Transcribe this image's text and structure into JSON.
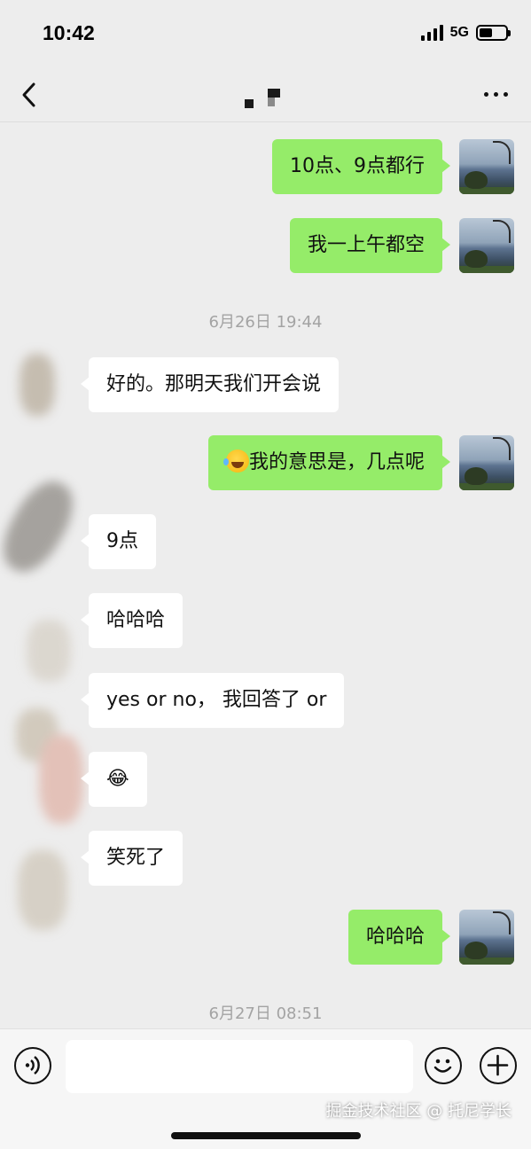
{
  "status_bar": {
    "time": "10:42",
    "network": "5G",
    "battery_level": 0.5
  },
  "nav": {
    "title": ""
  },
  "messages": [
    {
      "direction": "out",
      "text": "10点、9点都行"
    },
    {
      "direction": "out",
      "text": "我一上午都空"
    },
    {
      "type": "timestamp",
      "text": "6月26日 19:44"
    },
    {
      "direction": "in",
      "text": "好的。那明天我们开会说"
    },
    {
      "direction": "out",
      "text": "我的意思是，几点呢",
      "emoji": "crying-laughing-emoji"
    },
    {
      "direction": "in",
      "text": "9点"
    },
    {
      "direction": "in",
      "text": "哈哈哈"
    },
    {
      "direction": "in",
      "text": "yes or no， 我回答了 or"
    },
    {
      "direction": "in",
      "text": "😂"
    },
    {
      "direction": "in",
      "text": "笑死了"
    },
    {
      "direction": "out",
      "text": "哈哈哈"
    },
    {
      "type": "timestamp",
      "text": "6月27日 08:51"
    }
  ],
  "input_bar": {
    "placeholder": ""
  },
  "watermark": "掘金技术社区 @ 托尼学长",
  "colors": {
    "outgoing_bubble": "#95ec69",
    "incoming_bubble": "#ffffff",
    "background": "#ededed",
    "timestamp": "#a3a3a3"
  },
  "icons": [
    "back-icon",
    "more-icon",
    "voice-icon",
    "emoji-icon",
    "plus-icon"
  ]
}
